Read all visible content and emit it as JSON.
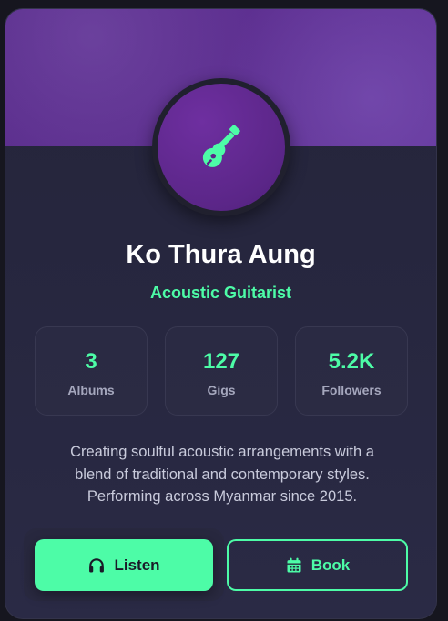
{
  "profile": {
    "name": "Ko Thura Aung",
    "role": "Acoustic Guitarist",
    "avatar_icon": "guitar-icon"
  },
  "stats": [
    {
      "value": "3",
      "label": "Albums"
    },
    {
      "value": "127",
      "label": "Gigs"
    },
    {
      "value": "5.2K",
      "label": "Followers"
    }
  ],
  "bio": {
    "lines": [
      "Creating soulful acoustic arrangements with a",
      "blend of traditional and contemporary styles.",
      "Performing across Myanmar since 2015."
    ]
  },
  "actions": {
    "listen_label": "Listen",
    "listen_icon": "headphones-icon",
    "book_label": "Book",
    "book_icon": "calendar-icon"
  },
  "colors": {
    "accent": "#4dfca7",
    "banner": "#5c2e8e",
    "avatar": "#5b2688",
    "card": "#24243a"
  }
}
